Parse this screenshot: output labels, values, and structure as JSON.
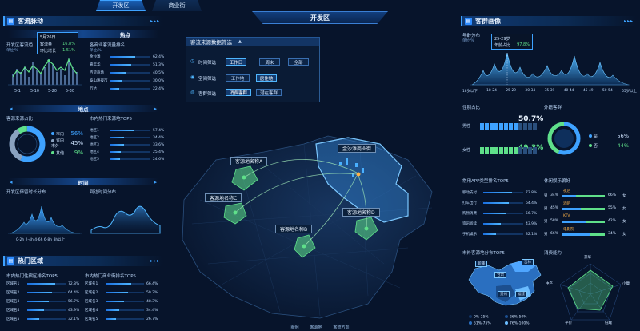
{
  "top_tabs": {
    "left": "开发区",
    "right": "商业街"
  },
  "title": "开发区",
  "colors": {
    "accent": "#3ea2ff",
    "green": "#5fe08a",
    "panel": "#0b2a52",
    "bg": "#07142b"
  },
  "left": {
    "flow_pulse": {
      "title": "客流脉动",
      "sub_title_visible": "热点",
      "tooltip": {
        "date": "5月26日",
        "row1_label": "客流量",
        "row1_value": "16.8%",
        "row2_label": "环比增长",
        "row2_value": "1.51%"
      },
      "chart_left_label": "开发区客流趋",
      "chart_right_label": "各商业客流量排名",
      "unit": "单位/%",
      "x_ticks": [
        "5-1",
        "5-10",
        "5-20",
        "5-30"
      ],
      "ranks": [
        {
          "name": "金沙滩",
          "value": "62.4%",
          "pct": 0.624
        },
        {
          "name": "嘉年华",
          "value": "51.3%",
          "pct": 0.513
        },
        {
          "name": "百货商场",
          "value": "40.5%",
          "pct": 0.405
        },
        {
          "name": "泰山路夜市",
          "value": "30.0%",
          "pct": 0.3
        },
        {
          "name": "万达",
          "value": "22.4%",
          "pct": 0.224
        }
      ]
    },
    "location": {
      "sub_title": "地点",
      "left_label": "客源来源占比",
      "right_label": "市内热门来源地TOP5",
      "donut_legend": [
        {
          "name": "市内",
          "value": "56%",
          "color": "#3ea2ff"
        },
        {
          "name": "省内\n市外",
          "value": "45%",
          "color": "#8aa2c0"
        },
        {
          "name": "其他",
          "value": "9%",
          "color": "#5fe08a"
        }
      ],
      "ranks": [
        {
          "name": "地区1",
          "value": "57.4%",
          "pct": 0.574
        },
        {
          "name": "地区2",
          "value": "34.4%",
          "pct": 0.344
        },
        {
          "name": "地区3",
          "value": "33.6%",
          "pct": 0.336
        },
        {
          "name": "地区4",
          "value": "25.4%",
          "pct": 0.254
        },
        {
          "name": "地区5",
          "value": "24.6%",
          "pct": 0.246
        }
      ]
    },
    "time": {
      "sub_title": "时间",
      "left_label": "开发区停留时长分布",
      "right_label": "到达时间分布",
      "left_x_ticks": [
        "0-2h",
        "2-4h",
        "4-6h",
        "6-8h",
        "8h以上"
      ]
    },
    "hot_area": {
      "title": "热门区域",
      "left_label": "市内热门住宿区排名TOP5",
      "right_label": "市内热门商业街排名TOP5",
      "left_ranks": [
        {
          "name": "区域名1",
          "value": "72.8%",
          "pct": 0.728
        },
        {
          "name": "区域名2",
          "value": "64.4%",
          "pct": 0.644
        },
        {
          "name": "区域名3",
          "value": "56.7%",
          "pct": 0.567
        },
        {
          "name": "区域名4",
          "value": "43.9%",
          "pct": 0.439
        },
        {
          "name": "区域名5",
          "value": "32.1%",
          "pct": 0.321
        }
      ],
      "right_ranks": [
        {
          "name": "区域名1",
          "value": "66.4%",
          "pct": 0.664
        },
        {
          "name": "区域名2",
          "value": "59.2%",
          "pct": 0.592
        },
        {
          "name": "区域名3",
          "value": "48.3%",
          "pct": 0.483
        },
        {
          "name": "区域名4",
          "value": "34.4%",
          "pct": 0.344
        },
        {
          "name": "区域名5",
          "value": "26.7%",
          "pct": 0.267
        }
      ]
    }
  },
  "center": {
    "filter": {
      "title": "客流来源数据筛选",
      "rows": [
        {
          "label": "时间筛选",
          "buttons": [
            "工作日",
            "周末",
            "全部"
          ],
          "active": 0
        },
        {
          "label": "空间筛选",
          "buttons": [
            "工作地",
            "居住地"
          ],
          "active": 1
        },
        {
          "label": "客群筛选",
          "buttons": [
            "消费客群",
            "潜在客群"
          ],
          "active": 0
        }
      ]
    },
    "map_labels": {
      "center": "金沙滩商业街",
      "a": "客源地名称A",
      "b": "客源地名称B",
      "c": "客源地名称C",
      "d": "客源地名称D"
    }
  },
  "right": {
    "portrait": {
      "title": "客群画像",
      "age_label": "年龄分布",
      "unit": "单位/%",
      "tooltip": {
        "range": "25-29岁",
        "label": "年龄占比",
        "value": "97.8%"
      },
      "age_ticks": [
        "18岁以下",
        "18-24",
        "25-29",
        "30-34",
        "35-39",
        "40-44",
        "45-49",
        "50-54",
        "55岁以上"
      ]
    },
    "gender": {
      "label": "性别占比",
      "male_label": "男性",
      "male_value": "50.7%",
      "female_label": "女性",
      "female_value": "49.3%"
    },
    "visitors": {
      "label": "外籍客群",
      "legend": [
        {
          "name": "是",
          "value": "56%",
          "color": "#3ea2ff"
        },
        {
          "name": "否",
          "value": "44%",
          "color": "#5fe08a"
        }
      ]
    },
    "app": {
      "label": "常用APP类型排名TOP5",
      "ranks": [
        {
          "name": "移动支付",
          "value": "72.8%",
          "pct": 0.728
        },
        {
          "name": "打车出行",
          "value": "64.4%",
          "pct": 0.644
        },
        {
          "name": "购物消费",
          "value": "56.7%",
          "pct": 0.567
        },
        {
          "name": "资讯阅读",
          "value": "43.9%",
          "pct": 0.439
        },
        {
          "name": "手机娱乐",
          "value": "32.1%",
          "pct": 0.321
        }
      ]
    },
    "leisure": {
      "label": "休闲娱乐偏好",
      "rows": [
        {
          "name": "夜店",
          "male": "34%",
          "female": "66%",
          "male_pct": 0.34
        },
        {
          "name": "酒吧",
          "male": "45%",
          "female": "55%",
          "male_pct": 0.45
        },
        {
          "name": "KTV",
          "male": "58%",
          "female": "42%",
          "male_pct": 0.58
        },
        {
          "name": "电影院",
          "male": "66%",
          "female": "34%",
          "male_pct": 0.66
        }
      ],
      "male_label": "男",
      "female_label": "女"
    },
    "china_map": {
      "label": "市外客源地分布TOP5",
      "provinces": [
        "新疆",
        "甘肃",
        "贵州",
        "福建",
        "吉林"
      ],
      "legend": [
        "0%-25%",
        "26%-50%",
        "51%-75%",
        "76%-100%"
      ]
    },
    "consumption": {
      "label": "消费能力",
      "axes": [
        "豪华",
        "小康",
        "低端",
        "平价",
        "中产"
      ]
    }
  },
  "bottom_legend": [
    "图例",
    "客源地",
    "客流方向"
  ]
}
